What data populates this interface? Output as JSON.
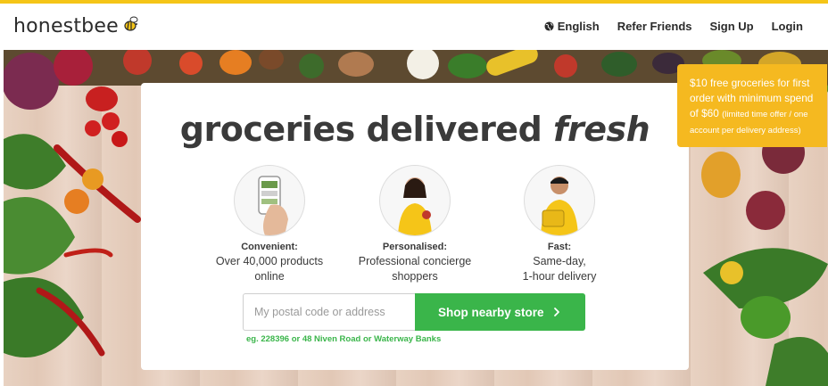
{
  "header": {
    "logo_text": "honestbee",
    "nav": {
      "language": "English",
      "refer": "Refer Friends",
      "signup": "Sign Up",
      "login": "Login"
    }
  },
  "hero": {
    "headline_main": "groceries delivered ",
    "headline_em": "fresh",
    "features": [
      {
        "title": "Convenient:",
        "desc_line1": "Over 40,000 products",
        "desc_line2": "online"
      },
      {
        "title": "Personalised:",
        "desc_line1": "Professional concierge",
        "desc_line2": "shoppers"
      },
      {
        "title": "Fast:",
        "desc_line1": "Same-day,",
        "desc_line2": "1-hour delivery"
      }
    ],
    "search": {
      "placeholder": "My postal code or address",
      "button_label": "Shop nearby store",
      "hint": "eg. 228396 or 48 Niven Road or Waterway Banks"
    }
  },
  "promo": {
    "line_main": "$10 free groceries for first order with minimum spend of $60",
    "line_small": "(limited time offer / one account per delivery address)"
  },
  "colors": {
    "accent_yellow": "#f5c518",
    "promo_yellow": "#f5b920",
    "cta_green": "#3ab54a",
    "text_dark": "#3a3a3a"
  },
  "icons": [
    "bee-logo-icon",
    "globe-icon",
    "chevron-right-icon"
  ]
}
